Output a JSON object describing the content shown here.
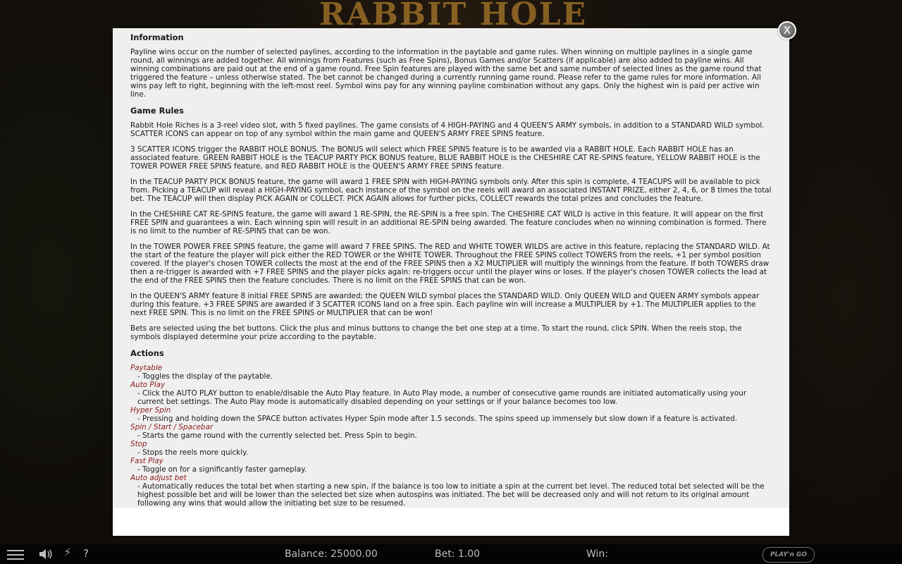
{
  "game": {
    "logo_text": "RABBIT HOLE"
  },
  "dialog": {
    "close_label": "X",
    "information": {
      "heading": "Information",
      "text": "Payline wins occur on the number of selected paylines, according to the information in the paytable and game rules. When winning on multiple paylines in a single game round, all winnings are added together. All winnings from Features (such as Free Spins), Bonus Games and/or Scatters (if applicable) are also added to payline wins. All winning combinations are paid out at the end of a game round. Free Spin features are played with the same bet and same number of selected lines as the game round that triggered the feature – unless otherwise stated. The bet cannot be changed during a currently running game round. Please refer to the game rules for more information. All wins pay left to right, beginning with the left-most reel. Symbol wins pay for any winning payline combination without any gaps. Only the highest win is paid per active win line."
    },
    "game_rules": {
      "heading": "Game Rules",
      "paragraphs": [
        "Rabbit Hole Riches is a 3-reel video slot, with 5 fixed paylines. The game consists of 4 HIGH-PAYING and 4 QUEEN'S ARMY symbols, in addition to a STANDARD WILD symbol. SCATTER ICONS can appear on top of any symbol within the main game and QUEEN'S ARMY FREE SPINS feature.",
        "3 SCATTER ICONS trigger the RABBIT HOLE BONUS. The BONUS will select which FREE SPINS feature is to be awarded via a RABBIT HOLE. Each RABBIT HOLE has an associated feature. GREEN RABBIT HOLE is the TEACUP PARTY PICK BONUS feature, BLUE RABBIT HOLE is the CHESHIRE CAT RE-SPINS feature, YELLOW RABBIT HOLE is the TOWER POWER FREE SPINS feature, and RED RABBIT HOLE is the QUEEN'S ARMY FREE SPINS feature.",
        "In the TEACUP PARTY PICK BONUS feature, the game will award 1 FREE SPIN with HIGH-PAYING symbols only. After this spin is complete, 4 TEACUPS will be available to pick from. Picking a TEACUP will reveal a HIGH-PAYING symbol, each instance of the symbol on the reels will award an associated INSTANT PRIZE, either 2, 4, 6, or 8 times the total bet. The TEACUP will then display PICK AGAIN or COLLECT. PICK AGAIN allows for further picks, COLLECT rewards the total prizes and concludes the feature.",
        "In the CHESHIRE CAT RE-SPINS feature, the game will award 1 RE-SPIN, the RE-SPIN is a free spin. The CHESHIRE CAT WILD is active in this feature. It will appear on the first FREE SPIN and guarantees a win. Each winning spin will result in an additional RE-SPIN being awarded. The feature concludes when no winning combination is formed. There is no limit to the number of RE-SPINS that can be won.",
        "In the TOWER POWER FREE SPINS feature, the game will award 7 FREE SPINS. The RED and WHITE TOWER WILDS are active in this feature, replacing the STANDARD WILD. At the start of the feature the player will pick either the RED TOWER or the WHITE TOWER. Throughout the FREE SPINS collect TOWERS from the reels, +1 per symbol position covered. If the player's chosen TOWER collects the most at the end of the FREE SPINS then a X2 MULTIPLIER will multiply the winnings from the feature. If both TOWERS draw then a re-trigger is awarded with +7 FREE SPINS and the player picks again: re-triggers occur until the player wins or loses. If the player's chosen TOWER collects the lead at the end of the FREE SPINS then the feature concludes. There is no limit on the FREE SPINS that can be won.",
        "In the QUEEN'S ARMY feature 8 initial FREE SPINS are awarded; the QUEEN WILD symbol places the STANDARD WILD. Only QUEEN WILD and QUEEN ARMY symbols appear during this feature. +3 FREE SPINS are awarded if 3 SCATTER ICONS land on a free spin. Each payline win will increase a MULTIPLIER by +1. The MULTIPLIER applies to the next FREE SPIN. This is no limit on the FREE SPINS or MULTIPLIER that can be won!",
        "Bets are selected using the bet buttons. Click the plus and minus buttons to change the bet one step at a time. To start the round, click SPIN. When the reels stop, the symbols displayed determine your prize according to the paytable."
      ]
    },
    "actions": {
      "heading": "Actions",
      "items": [
        {
          "title": "Paytable",
          "desc": "- Toggles the display of the paytable."
        },
        {
          "title": "Auto Play",
          "desc": "- Click the AUTO PLAY button to enable/disable the Auto Play feature. In Auto Play mode, a number of consecutive game rounds are initiated automatically using your current bet settings. The Auto Play mode is automatically disabled depending on your settings or if your balance becomes too low."
        },
        {
          "title": "Hyper Spin",
          "desc": "- Pressing and holding down the SPACE button activates Hyper Spin mode after 1.5 seconds. The spins speed up immensely but slow down if a feature is activated."
        },
        {
          "title": "Spin / Start / Spacebar",
          "desc": "- Starts the game round with the currently selected bet. Press Spin to begin."
        },
        {
          "title": "Stop",
          "desc": "- Stops the reels more quickly."
        },
        {
          "title": "Fast Play",
          "desc": "- Toggle on for a significantly faster gameplay."
        },
        {
          "title": "Auto adjust bet",
          "desc": "- Automatically reduces the total bet when starting a new spin, if the balance is too low to initiate a spin at the current bet level. The reduced total bet selected will be the highest possible bet and will be lower than the selected bet size when autospins was initiated. The bet will be decreased only and will not return to its original amount following any wins that would allow the initiating bet size to be resumed."
        }
      ]
    }
  },
  "bottom_bar": {
    "menu_icon": "menu-icon",
    "sound_icon": "speaker-icon",
    "bolt_icon": "lightning-icon",
    "help_label": "?",
    "balance_text": "Balance: 25000.00",
    "bet_text": "Bet: 1.00",
    "win_text": "Win:",
    "brand_text": "PLAY'n GO"
  },
  "colors": {
    "action_title": "#8b1a1a",
    "panel_bg": "#efefef"
  }
}
